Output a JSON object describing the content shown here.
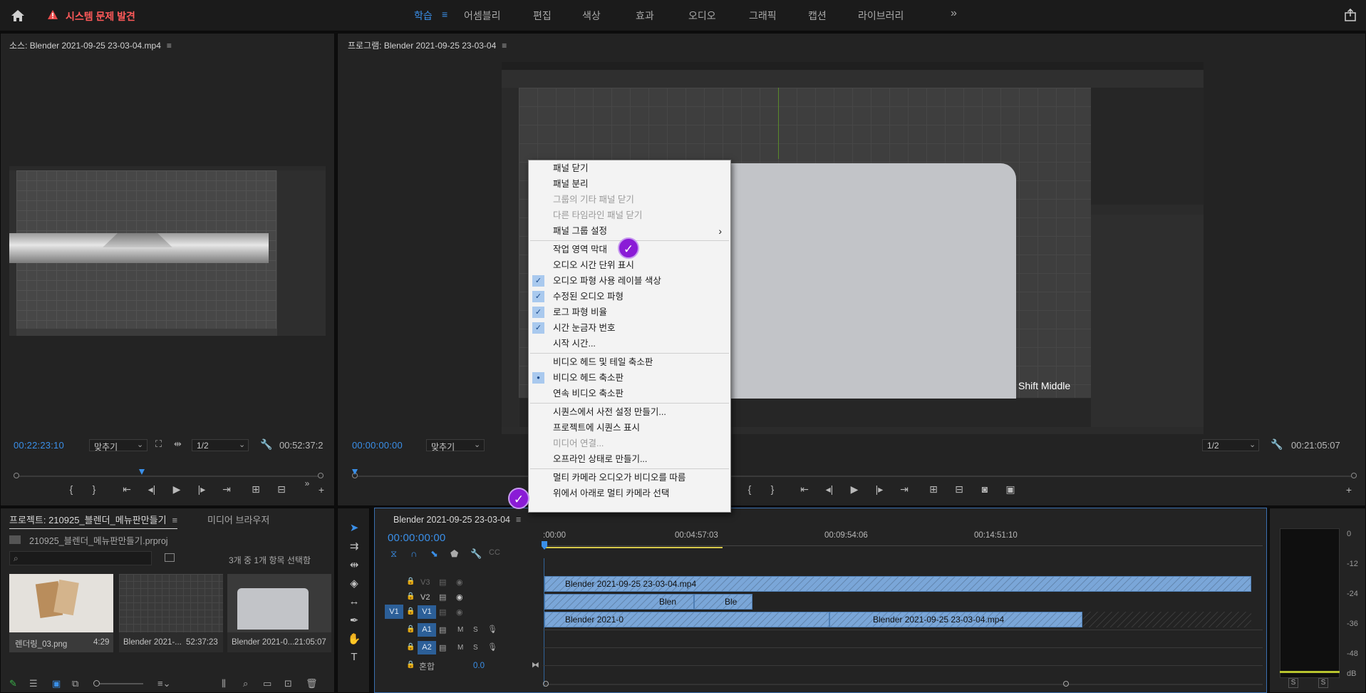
{
  "topbar": {
    "alert": "시스템 문제 발견",
    "workspaces": [
      {
        "label": "학습",
        "active": true
      },
      {
        "label": "어셈블리"
      },
      {
        "label": "편집"
      },
      {
        "label": "색상"
      },
      {
        "label": "효과"
      },
      {
        "label": "오디오"
      },
      {
        "label": "그래픽"
      },
      {
        "label": "캡션"
      },
      {
        "label": "라이브러리"
      }
    ],
    "more": "»"
  },
  "source_monitor": {
    "title": "소스: Blender 2021-09-25 23-03-04.mp4",
    "timecode": "00:22:23:10",
    "fit": "맞추기",
    "resolution": "1/2",
    "duration": "00:52:37:2"
  },
  "program_monitor": {
    "title": "프로그램: Blender 2021-09-25 23-03-04",
    "timecode": "00:00:00:00",
    "fit": "맞추기",
    "resolution": "1/2",
    "duration": "00:21:05:07",
    "overlay_text": "Shift Middle"
  },
  "context_menu": {
    "items": [
      {
        "label": "패널 닫기"
      },
      {
        "label": "패널 분리"
      },
      {
        "label": "그룹의 기타 패널 닫기",
        "disabled": true
      },
      {
        "label": "다른 타임라인 패널 닫기",
        "disabled": true
      },
      {
        "label": "패널 그룹 설정",
        "submenu": "›"
      },
      {
        "label": "작업 영역 막대"
      },
      {
        "label": "오디오 시간 단위 표시"
      },
      {
        "label": "오디오 파형 사용 레이블 색상",
        "checked": true
      },
      {
        "label": "수정된 오디오 파형",
        "checked": true
      },
      {
        "label": "로그 파형 비율",
        "checked": true
      },
      {
        "label": "시간 눈금자 번호",
        "checked": true
      },
      {
        "label": "시작 시간..."
      },
      {
        "label": "비디오 헤드 및 테일 축소판"
      },
      {
        "label": "비디오 헤드 축소판",
        "radio": true
      },
      {
        "label": "연속 비디오 축소판"
      },
      {
        "label": "시퀀스에서 사전 설정 만들기..."
      },
      {
        "label": "프로젝트에 시퀀스 표시"
      },
      {
        "label": "미디어 연결...",
        "disabled": true
      },
      {
        "label": "오프라인 상태로 만들기..."
      },
      {
        "label": "멀티 카메라 오디오가 비디오를 따름"
      },
      {
        "label": "위에서 아래로 멀티 카메라 선택"
      }
    ],
    "check_glyph": "✓",
    "radio_glyph": "●"
  },
  "project_panel": {
    "tab_project": "프로젝트: 210925_블렌더_메뉴판만들기",
    "tab_media": "미디어 브라우저",
    "file": "210925_블렌더_메뉴판만들기.prproj",
    "count": "3개 중 1개 항목 선택함",
    "items": [
      {
        "name": "렌더링_03.png",
        "duration": "4:29"
      },
      {
        "name": "Blender 2021-...",
        "duration": "52:37:23"
      },
      {
        "name": "Blender 2021-0...",
        "duration": "21:05:07"
      }
    ]
  },
  "timeline": {
    "tab": "Blender 2021-09-25 23-03-04",
    "timecode": "00:00:00:00",
    "ruler": [
      ":00:00",
      "00:04:57:03",
      "00:09:54:06",
      "00:14:51:10"
    ],
    "tracks": {
      "v3": "V3",
      "v2": "V2",
      "v1": "V1",
      "v1_src": "V1",
      "a1": "A1",
      "a2": "A2",
      "m": "M",
      "s": "S",
      "mix_label": "혼합",
      "mix_value": "0.0"
    },
    "clips": {
      "v3": "Blender 2021-09-25 23-03-04.mp4",
      "v2_a": "Blen",
      "v2_b": "Ble",
      "v1_a": "Blender 2021-0",
      "v1_b": "Blender 2021-09-25 23-03-04.mp4"
    }
  },
  "meters": {
    "scale": [
      "0",
      "-12",
      "-24",
      "-36",
      "-48",
      "dB"
    ],
    "solo": "S"
  },
  "colors": {
    "accent": "#3a8fe8",
    "alert": "#e84a4a",
    "clip": "#7aa6d8",
    "badge": "#8a1bd6"
  }
}
